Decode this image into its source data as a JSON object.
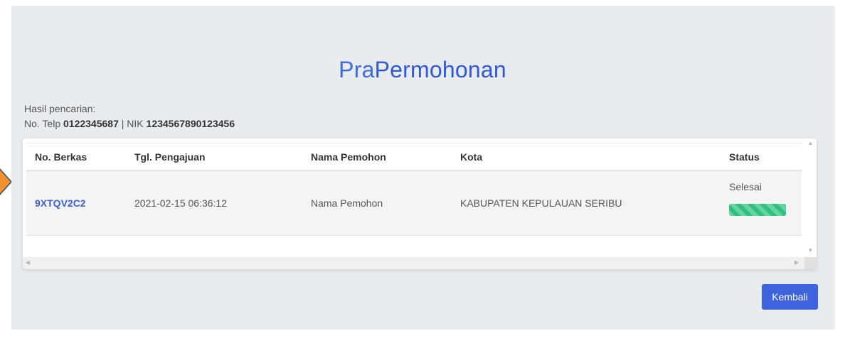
{
  "title": {
    "part1": "Pra",
    "part2": "Permohonan"
  },
  "search": {
    "label": "Hasil pencarian:",
    "telp_label": "No. Telp",
    "telp_value": "0122345687",
    "separator": "|",
    "nik_label": "NIK",
    "nik_value": "1234567890123456"
  },
  "table": {
    "headers": [
      "No. Berkas",
      "Tgl. Pengajuan",
      "Nama Pemohon",
      "Kota",
      "Status"
    ],
    "rows": [
      {
        "berkas": "9XTQV2C2",
        "tanggal": "2021-02-15 06:36:12",
        "nama": "Nama Pemohon",
        "kota": "KABUPATEN KEPULAUAN SERIBU",
        "status": "Selesai",
        "progress_percent": 100
      }
    ]
  },
  "scrollbar": {
    "up": "▲",
    "down": "▼",
    "left": "◀",
    "right": "▶"
  },
  "buttons": {
    "back_label": "Kembali"
  },
  "colors": {
    "accent": "#3e63dd",
    "panel_bg": "#e9ecef",
    "progress": "#2ec27e",
    "pointer": "#f0922e"
  },
  "icons": {
    "pointer": "arrow-pointer-icon"
  }
}
